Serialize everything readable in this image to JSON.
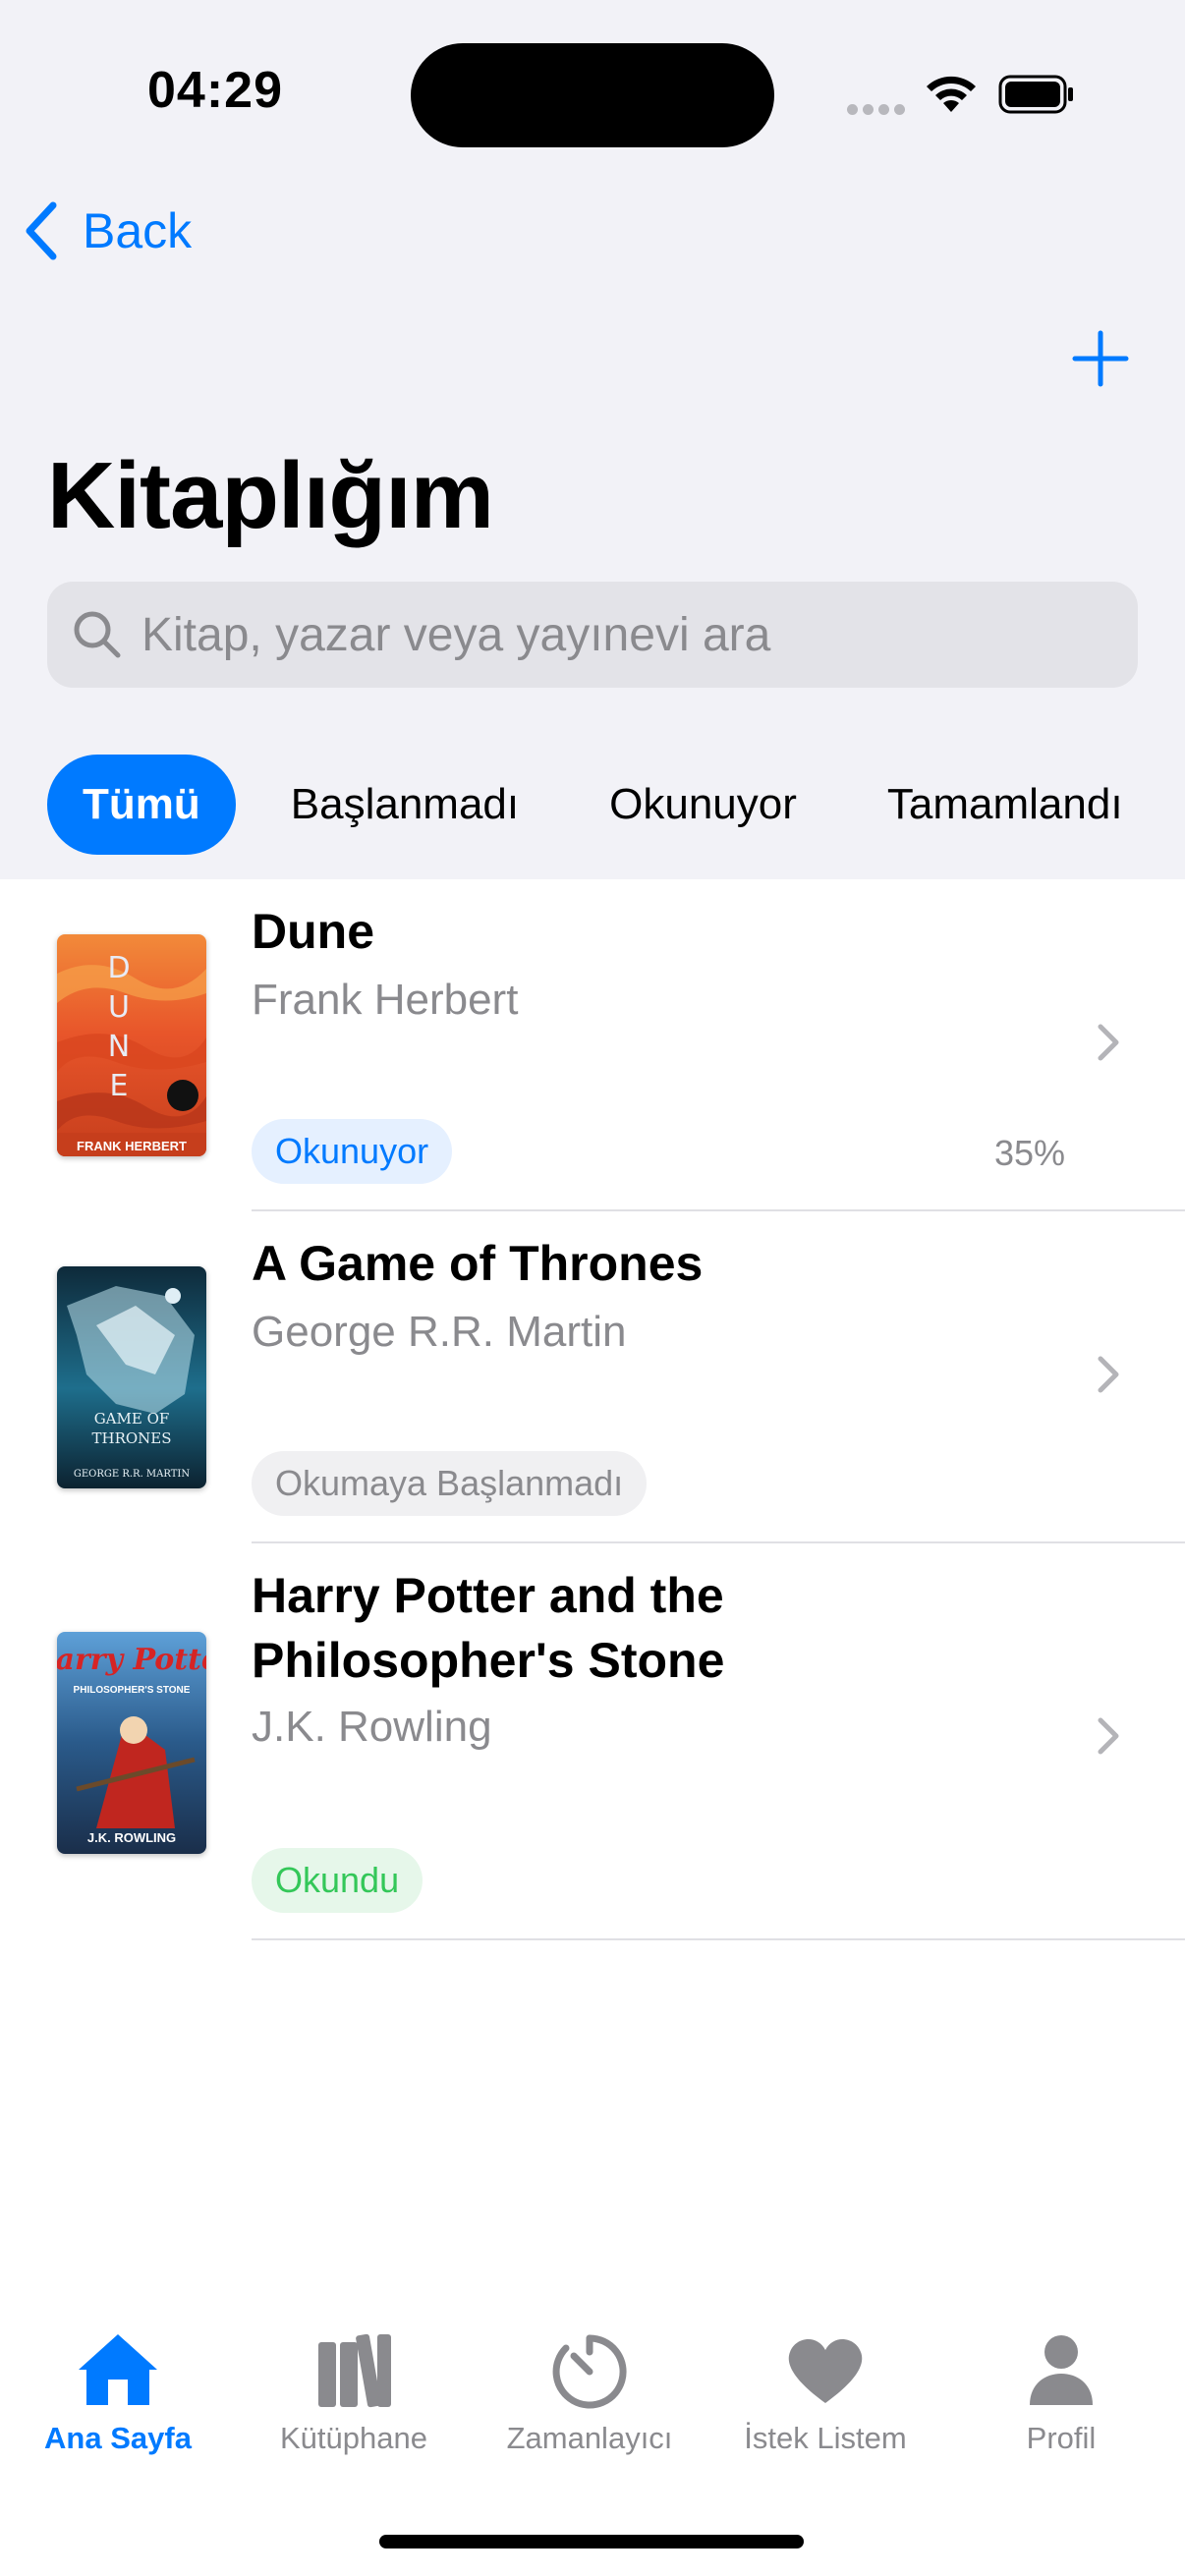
{
  "status_bar": {
    "time": "04:29"
  },
  "nav": {
    "back_label": "Back"
  },
  "page": {
    "title": "Kitaplığım"
  },
  "search": {
    "placeholder": "Kitap, yazar veya yayınevi ara"
  },
  "filters": [
    {
      "label": "Tümü",
      "active": true
    },
    {
      "label": "Başlanmadı",
      "active": false
    },
    {
      "label": "Okunuyor",
      "active": false
    },
    {
      "label": "Tamamlandı",
      "active": false
    }
  ],
  "books": [
    {
      "title": "Dune",
      "author": "Frank Herbert",
      "status": "Okunuyor",
      "progress": "35%",
      "cover_text": "DUNE",
      "cover_author": "FRANK HERBERT",
      "cover_color": "#e8552a"
    },
    {
      "title": "A Game of Thrones",
      "author": "George R.R. Martin",
      "status": "Okumaya Başlanmadı",
      "cover_text": "GAME OF THRONES",
      "cover_author": "GEORGE R.R. MARTIN",
      "cover_color": "#1e6e8c"
    },
    {
      "title": "Harry Potter and the Philosopher's Stone",
      "author": "J.K. Rowling",
      "status": "Okundu",
      "cover_text": "Harry Potter",
      "cover_subtitle": "PHILOSOPHER'S STONE",
      "cover_author": "J.K. ROWLING",
      "cover_color": "#2a5a8a"
    }
  ],
  "tab_bar": [
    {
      "label": "Ana Sayfa",
      "icon": "house-icon",
      "active": true
    },
    {
      "label": "Kütüphane",
      "icon": "books-icon",
      "active": false
    },
    {
      "label": "Zamanlayıcı",
      "icon": "timer-icon",
      "active": false
    },
    {
      "label": "İstek Listem",
      "icon": "heart-icon",
      "active": false
    },
    {
      "label": "Profil",
      "icon": "person-icon",
      "active": false
    }
  ],
  "colors": {
    "accent": "#007aff",
    "success": "#34c759",
    "secondary_text": "#8a8a8e",
    "header_bg": "#f2f2f7"
  }
}
